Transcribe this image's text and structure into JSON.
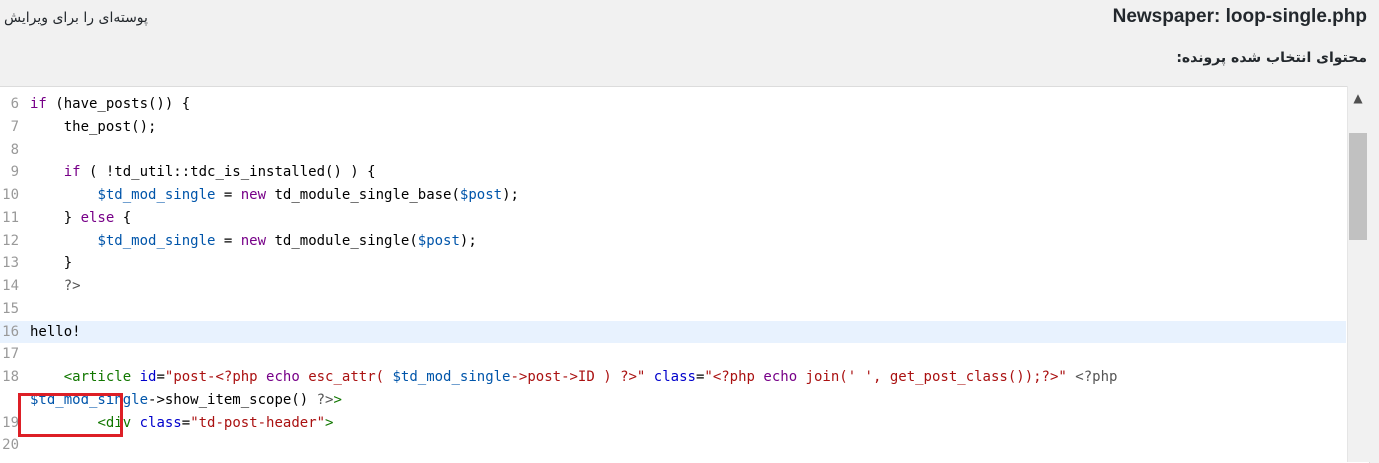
{
  "header": {
    "file_title": "Newspaper: loop-single.php",
    "select_label": "پوسته‌ای را برای ویرایش",
    "content_label": "محتوای انتخاب شده پرونده:"
  },
  "editor": {
    "line_numbers": [
      "6",
      "7",
      "8",
      "9",
      "10",
      "11",
      "12",
      "13",
      "14",
      "15",
      "16",
      "17",
      "18",
      "19",
      "20"
    ],
    "lines": [
      "if (have_posts()) {",
      "    the_post();",
      "",
      "    if ( !td_util::tdc_is_installed() ) {",
      "        $td_mod_single = new td_module_single_base($post);",
      "    } else {",
      "        $td_mod_single = new td_module_single($post);",
      "    }",
      "    ?>",
      "",
      "hello!",
      "",
      "    <article id=\"post-<?php echo esc_attr( $td_mod_single->post->ID ) ?>\" class=\"<?php echo join(' ', get_post_class());?>\" <?php",
      "$td_mod_single->show_item_scope() ?>>",
      "        <div class=\"td-post-header\">",
      ""
    ]
  },
  "scrollbar": {
    "up_icon": "▲"
  },
  "colors": {
    "highlight_box": "#dd1f26",
    "active_line": "#e8f2fe"
  }
}
